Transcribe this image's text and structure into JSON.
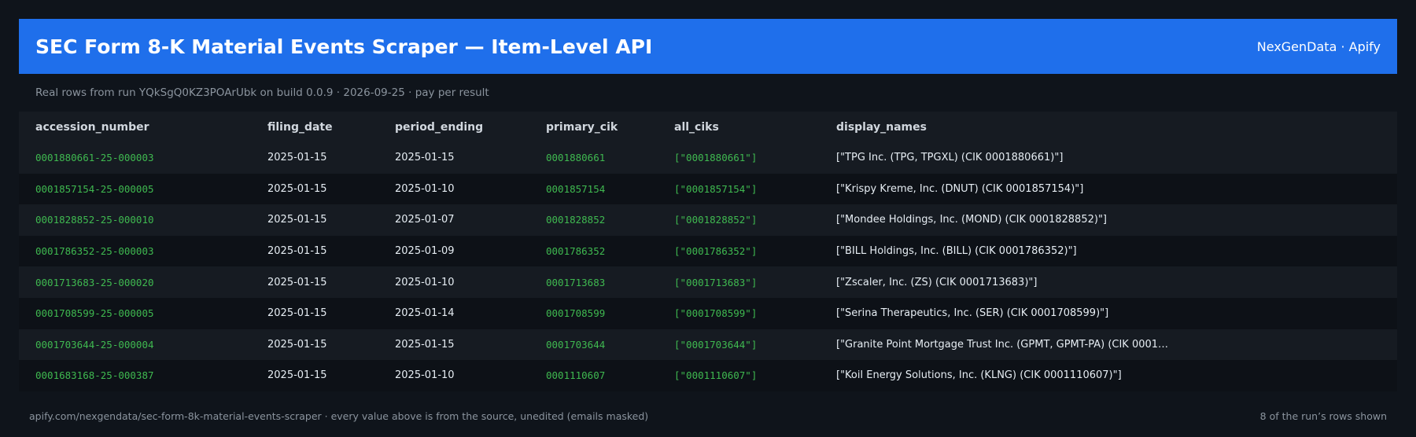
{
  "header": {
    "title": "SEC Form 8-K Material Events Scraper — Item-Level API",
    "brand": "NexGenData · Apify"
  },
  "subtitle": "Real rows from run YQkSgQ0KZ3POArUbk on build 0.0.9 · 2026-09-25 · pay per result",
  "table": {
    "columns": [
      "accession_number",
      "filing_date",
      "period_ending",
      "primary_cik",
      "all_ciks",
      "display_names"
    ],
    "rows": [
      [
        "0001880661-25-000003",
        "2025-01-15",
        "2025-01-15",
        "0001880661",
        "[\"0001880661\"]",
        "[\"TPG Inc. (TPG, TPGXL) (CIK 0001880661)\"]"
      ],
      [
        "0001857154-25-000005",
        "2025-01-15",
        "2025-01-10",
        "0001857154",
        "[\"0001857154\"]",
        "[\"Krispy Kreme, Inc. (DNUT) (CIK 0001857154)\"]"
      ],
      [
        "0001828852-25-000010",
        "2025-01-15",
        "2025-01-07",
        "0001828852",
        "[\"0001828852\"]",
        "[\"Mondee Holdings, Inc. (MOND) (CIK 0001828852)\"]"
      ],
      [
        "0001786352-25-000003",
        "2025-01-15",
        "2025-01-09",
        "0001786352",
        "[\"0001786352\"]",
        "[\"BILL Holdings, Inc. (BILL) (CIK 0001786352)\"]"
      ],
      [
        "0001713683-25-000020",
        "2025-01-15",
        "2025-01-10",
        "0001713683",
        "[\"0001713683\"]",
        "[\"Zscaler, Inc. (ZS) (CIK 0001713683)\"]"
      ],
      [
        "0001708599-25-000005",
        "2025-01-15",
        "2025-01-14",
        "0001708599",
        "[\"0001708599\"]",
        "[\"Serina Therapeutics, Inc. (SER) (CIK 0001708599)\"]"
      ],
      [
        "0001703644-25-000004",
        "2025-01-15",
        "2025-01-15",
        "0001703644",
        "[\"0001703644\"]",
        "[\"Granite Point Mortgage Trust Inc. (GPMT, GPMT-PA) (CIK 0001…"
      ],
      [
        "0001683168-25-000387",
        "2025-01-15",
        "2025-01-10",
        "0001110607",
        "[\"0001110607\"]",
        "[\"Koil Energy Solutions, Inc. (KLNG) (CIK 0001110607)\"]"
      ]
    ]
  },
  "footer": {
    "left": "apify.com/nexgendata/sec-form-8k-material-events-scraper  ·  every value above is from the source, unedited (emails masked)",
    "right": "8 of the run’s rows shown"
  },
  "colors": {
    "header_bg": "#1f6feb",
    "page_bg": "#0f141b",
    "id_text": "#3fb950",
    "muted_text": "#8b949e"
  }
}
